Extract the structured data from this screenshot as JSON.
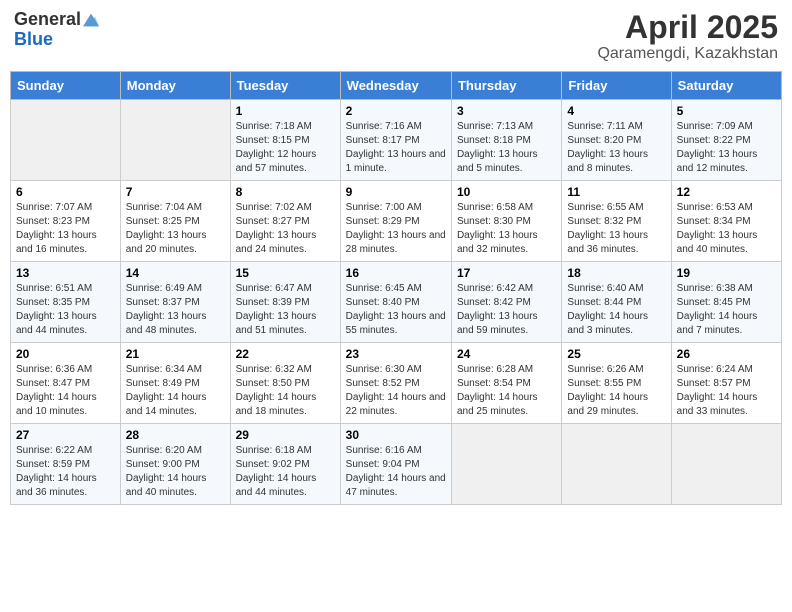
{
  "logo": {
    "general": "General",
    "blue": "Blue"
  },
  "title": "April 2025",
  "subtitle": "Qaramengdi, Kazakhstan",
  "days_of_week": [
    "Sunday",
    "Monday",
    "Tuesday",
    "Wednesday",
    "Thursday",
    "Friday",
    "Saturday"
  ],
  "weeks": [
    [
      {
        "day": "",
        "sunrise": "",
        "sunset": "",
        "daylight": ""
      },
      {
        "day": "",
        "sunrise": "",
        "sunset": "",
        "daylight": ""
      },
      {
        "day": "1",
        "sunrise": "Sunrise: 7:18 AM",
        "sunset": "Sunset: 8:15 PM",
        "daylight": "Daylight: 12 hours and 57 minutes."
      },
      {
        "day": "2",
        "sunrise": "Sunrise: 7:16 AM",
        "sunset": "Sunset: 8:17 PM",
        "daylight": "Daylight: 13 hours and 1 minute."
      },
      {
        "day": "3",
        "sunrise": "Sunrise: 7:13 AM",
        "sunset": "Sunset: 8:18 PM",
        "daylight": "Daylight: 13 hours and 5 minutes."
      },
      {
        "day": "4",
        "sunrise": "Sunrise: 7:11 AM",
        "sunset": "Sunset: 8:20 PM",
        "daylight": "Daylight: 13 hours and 8 minutes."
      },
      {
        "day": "5",
        "sunrise": "Sunrise: 7:09 AM",
        "sunset": "Sunset: 8:22 PM",
        "daylight": "Daylight: 13 hours and 12 minutes."
      }
    ],
    [
      {
        "day": "6",
        "sunrise": "Sunrise: 7:07 AM",
        "sunset": "Sunset: 8:23 PM",
        "daylight": "Daylight: 13 hours and 16 minutes."
      },
      {
        "day": "7",
        "sunrise": "Sunrise: 7:04 AM",
        "sunset": "Sunset: 8:25 PM",
        "daylight": "Daylight: 13 hours and 20 minutes."
      },
      {
        "day": "8",
        "sunrise": "Sunrise: 7:02 AM",
        "sunset": "Sunset: 8:27 PM",
        "daylight": "Daylight: 13 hours and 24 minutes."
      },
      {
        "day": "9",
        "sunrise": "Sunrise: 7:00 AM",
        "sunset": "Sunset: 8:29 PM",
        "daylight": "Daylight: 13 hours and 28 minutes."
      },
      {
        "day": "10",
        "sunrise": "Sunrise: 6:58 AM",
        "sunset": "Sunset: 8:30 PM",
        "daylight": "Daylight: 13 hours and 32 minutes."
      },
      {
        "day": "11",
        "sunrise": "Sunrise: 6:55 AM",
        "sunset": "Sunset: 8:32 PM",
        "daylight": "Daylight: 13 hours and 36 minutes."
      },
      {
        "day": "12",
        "sunrise": "Sunrise: 6:53 AM",
        "sunset": "Sunset: 8:34 PM",
        "daylight": "Daylight: 13 hours and 40 minutes."
      }
    ],
    [
      {
        "day": "13",
        "sunrise": "Sunrise: 6:51 AM",
        "sunset": "Sunset: 8:35 PM",
        "daylight": "Daylight: 13 hours and 44 minutes."
      },
      {
        "day": "14",
        "sunrise": "Sunrise: 6:49 AM",
        "sunset": "Sunset: 8:37 PM",
        "daylight": "Daylight: 13 hours and 48 minutes."
      },
      {
        "day": "15",
        "sunrise": "Sunrise: 6:47 AM",
        "sunset": "Sunset: 8:39 PM",
        "daylight": "Daylight: 13 hours and 51 minutes."
      },
      {
        "day": "16",
        "sunrise": "Sunrise: 6:45 AM",
        "sunset": "Sunset: 8:40 PM",
        "daylight": "Daylight: 13 hours and 55 minutes."
      },
      {
        "day": "17",
        "sunrise": "Sunrise: 6:42 AM",
        "sunset": "Sunset: 8:42 PM",
        "daylight": "Daylight: 13 hours and 59 minutes."
      },
      {
        "day": "18",
        "sunrise": "Sunrise: 6:40 AM",
        "sunset": "Sunset: 8:44 PM",
        "daylight": "Daylight: 14 hours and 3 minutes."
      },
      {
        "day": "19",
        "sunrise": "Sunrise: 6:38 AM",
        "sunset": "Sunset: 8:45 PM",
        "daylight": "Daylight: 14 hours and 7 minutes."
      }
    ],
    [
      {
        "day": "20",
        "sunrise": "Sunrise: 6:36 AM",
        "sunset": "Sunset: 8:47 PM",
        "daylight": "Daylight: 14 hours and 10 minutes."
      },
      {
        "day": "21",
        "sunrise": "Sunrise: 6:34 AM",
        "sunset": "Sunset: 8:49 PM",
        "daylight": "Daylight: 14 hours and 14 minutes."
      },
      {
        "day": "22",
        "sunrise": "Sunrise: 6:32 AM",
        "sunset": "Sunset: 8:50 PM",
        "daylight": "Daylight: 14 hours and 18 minutes."
      },
      {
        "day": "23",
        "sunrise": "Sunrise: 6:30 AM",
        "sunset": "Sunset: 8:52 PM",
        "daylight": "Daylight: 14 hours and 22 minutes."
      },
      {
        "day": "24",
        "sunrise": "Sunrise: 6:28 AM",
        "sunset": "Sunset: 8:54 PM",
        "daylight": "Daylight: 14 hours and 25 minutes."
      },
      {
        "day": "25",
        "sunrise": "Sunrise: 6:26 AM",
        "sunset": "Sunset: 8:55 PM",
        "daylight": "Daylight: 14 hours and 29 minutes."
      },
      {
        "day": "26",
        "sunrise": "Sunrise: 6:24 AM",
        "sunset": "Sunset: 8:57 PM",
        "daylight": "Daylight: 14 hours and 33 minutes."
      }
    ],
    [
      {
        "day": "27",
        "sunrise": "Sunrise: 6:22 AM",
        "sunset": "Sunset: 8:59 PM",
        "daylight": "Daylight: 14 hours and 36 minutes."
      },
      {
        "day": "28",
        "sunrise": "Sunrise: 6:20 AM",
        "sunset": "Sunset: 9:00 PM",
        "daylight": "Daylight: 14 hours and 40 minutes."
      },
      {
        "day": "29",
        "sunrise": "Sunrise: 6:18 AM",
        "sunset": "Sunset: 9:02 PM",
        "daylight": "Daylight: 14 hours and 44 minutes."
      },
      {
        "day": "30",
        "sunrise": "Sunrise: 6:16 AM",
        "sunset": "Sunset: 9:04 PM",
        "daylight": "Daylight: 14 hours and 47 minutes."
      },
      {
        "day": "",
        "sunrise": "",
        "sunset": "",
        "daylight": ""
      },
      {
        "day": "",
        "sunrise": "",
        "sunset": "",
        "daylight": ""
      },
      {
        "day": "",
        "sunrise": "",
        "sunset": "",
        "daylight": ""
      }
    ]
  ]
}
